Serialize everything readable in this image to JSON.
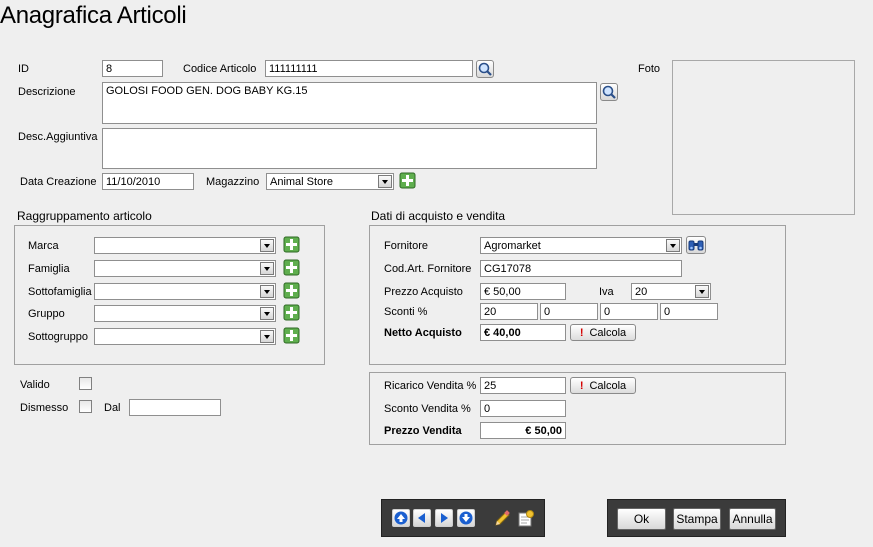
{
  "page": {
    "title": "Anagrafica Articoli"
  },
  "header": {
    "id_label": "ID",
    "id_value": "8",
    "codice_label": "Codice Articolo",
    "codice_value": "111111111",
    "foto_label": "Foto",
    "descrizione_label": "Descrizione",
    "descrizione_value": "GOLOSI FOOD GEN. DOG BABY KG.15",
    "desc_agg_label": "Desc.Aggiuntiva",
    "desc_agg_value": "",
    "data_creazione_label": "Data Creazione",
    "data_creazione_value": "11/10/2010",
    "magazzino_label": "Magazzino",
    "magazzino_value": "Animal Store"
  },
  "raggruppamento": {
    "title": "Raggruppamento articolo",
    "rows": [
      {
        "label": "Marca",
        "value": ""
      },
      {
        "label": "Famiglia",
        "value": ""
      },
      {
        "label": "Sottofamiglia",
        "value": ""
      },
      {
        "label": "Gruppo",
        "value": ""
      },
      {
        "label": "Sottogruppo",
        "value": ""
      }
    ]
  },
  "stato": {
    "valido_label": "Valido",
    "dismesso_label": "Dismesso",
    "dal_label": "Dal",
    "dal_value": ""
  },
  "acquisto": {
    "title": "Dati di acquisto e vendita",
    "fornitore_label": "Fornitore",
    "fornitore_value": "Agromarket",
    "cod_art_label": "Cod.Art. Fornitore",
    "cod_art_value": "CG17078",
    "prezzo_acq_label": "Prezzo Acquisto",
    "prezzo_acq_value": "€ 50,00",
    "iva_label": "Iva",
    "iva_value": "20",
    "sconti_label": "Sconti %",
    "sconti": [
      "20",
      "0",
      "0",
      "0"
    ],
    "netto_label": "Netto Acquisto",
    "netto_value": "€ 40,00",
    "calcola_label": "Calcola"
  },
  "vendita": {
    "ricarico_label": "Ricarico Vendita %",
    "ricarico_value": "25",
    "sconto_label": "Sconto Vendita %",
    "sconto_value": "0",
    "prezzo_label": "Prezzo Vendita",
    "prezzo_value": "€ 50,00",
    "calcola_label": "Calcola"
  },
  "footer": {
    "ok_label": "Ok",
    "stampa_label": "Stampa",
    "annulla_label": "Annulla"
  },
  "colors": {
    "toolbar": "#3b3b3b",
    "nav_arrow": "#1a5fd0",
    "add_icon": "#2f8a2f",
    "warn_icon": "#d40000"
  }
}
